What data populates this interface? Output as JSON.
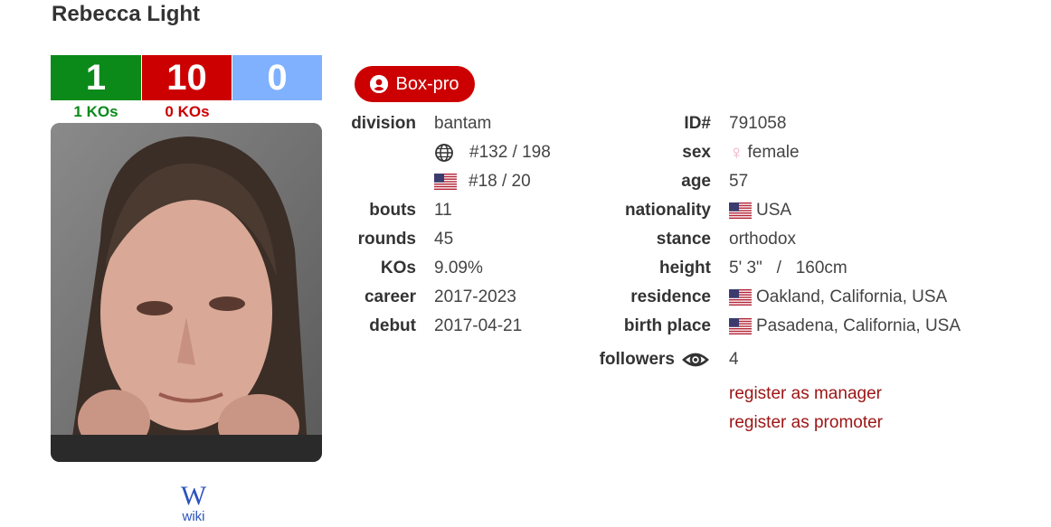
{
  "boxer": {
    "name": "Rebecca Light",
    "record": {
      "wins": "1",
      "losses": "10",
      "draws": "0"
    },
    "kos": {
      "win_kos": "1 KOs",
      "loss_kos": "0 KOs"
    },
    "wiki_label": "wiki"
  },
  "badge": {
    "label": "Box-pro",
    "icon": "user-circle-icon"
  },
  "left_stats": {
    "division_label": "division",
    "division": "bantam",
    "world_rank": "#132 / 198",
    "country_rank": "#18 / 20",
    "bouts_label": "bouts",
    "bouts": "11",
    "rounds_label": "rounds",
    "rounds": "45",
    "kos_label": "KOs",
    "kos": "9.09%",
    "career_label": "career",
    "career": "2017-2023",
    "debut_label": "debut",
    "debut": "2017-04-21"
  },
  "right_stats": {
    "id_label": "ID#",
    "id": "791058",
    "sex_label": "sex",
    "sex": "female",
    "age_label": "age",
    "age": "57",
    "nationality_label": "nationality",
    "nationality": "USA",
    "stance_label": "stance",
    "stance": "orthodox",
    "height_label": "height",
    "height": "5' 3\"   /   160cm",
    "residence_label": "residence",
    "residence": "Oakland, California, USA",
    "birth_place_label": "birth place",
    "birth_place": "Pasadena, California, USA",
    "followers_label": "followers",
    "followers": "4"
  },
  "links": {
    "register_manager": "register as manager",
    "register_promoter": "register as promoter"
  },
  "colors": {
    "win": "#0b8a1a",
    "loss": "#cc0000",
    "draw": "#7fb1ff",
    "link": "#9c1414",
    "female": "#f4a6c2"
  }
}
